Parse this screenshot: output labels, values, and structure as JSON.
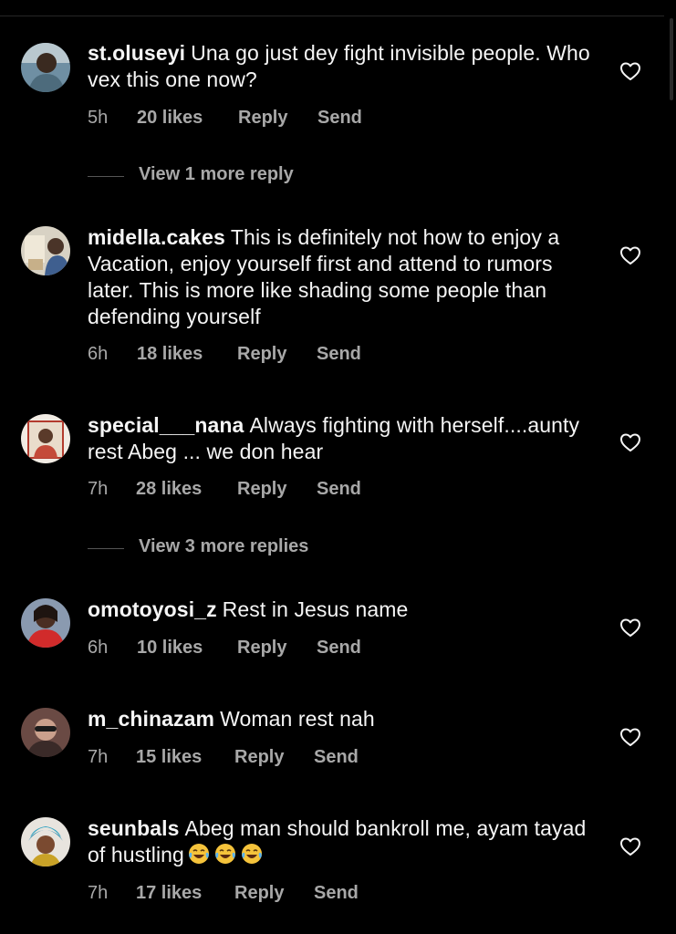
{
  "comments": [
    {
      "username": "st.oluseyi",
      "text": "Una go just dey fight invisible people. Who vex this one now?",
      "time": "5h",
      "likes": "20 likes",
      "reply": "Reply",
      "send": "Send"
    },
    {
      "username": "midella.cakes",
      "text": "This is definitely not how to enjoy a Vacation, enjoy yourself first and attend to rumors later. This is more like shading some people than defending yourself",
      "time": "6h",
      "likes": "18 likes",
      "reply": "Reply",
      "send": "Send"
    },
    {
      "username": "special___nana",
      "text": "Always fighting with herself....aunty rest Abeg ... we don hear",
      "time": "7h",
      "likes": "28 likes",
      "reply": "Reply",
      "send": "Send"
    },
    {
      "username": "omotoyosi_z",
      "text": "Rest in Jesus name",
      "time": "6h",
      "likes": "10 likes",
      "reply": "Reply",
      "send": "Send"
    },
    {
      "username": "m_chinazam",
      "text": "Woman rest nah",
      "time": "7h",
      "likes": "15 likes",
      "reply": "Reply",
      "send": "Send"
    },
    {
      "username": "seunbals",
      "text": "Abeg man should bankroll me, ayam tayad of hustling",
      "time": "7h",
      "likes": "17 likes",
      "reply": "Reply",
      "send": "Send"
    }
  ],
  "view_replies": [
    {
      "label": "View 1 more reply"
    },
    {
      "label": "View 3 more replies"
    }
  ],
  "icons": {
    "like": "heart-outline-icon",
    "emoji": "face-with-tears-of-joy-icon"
  },
  "colors": {
    "background": "#000000",
    "text_primary": "#f5f5f5",
    "text_secondary": "#a8a8a8"
  }
}
